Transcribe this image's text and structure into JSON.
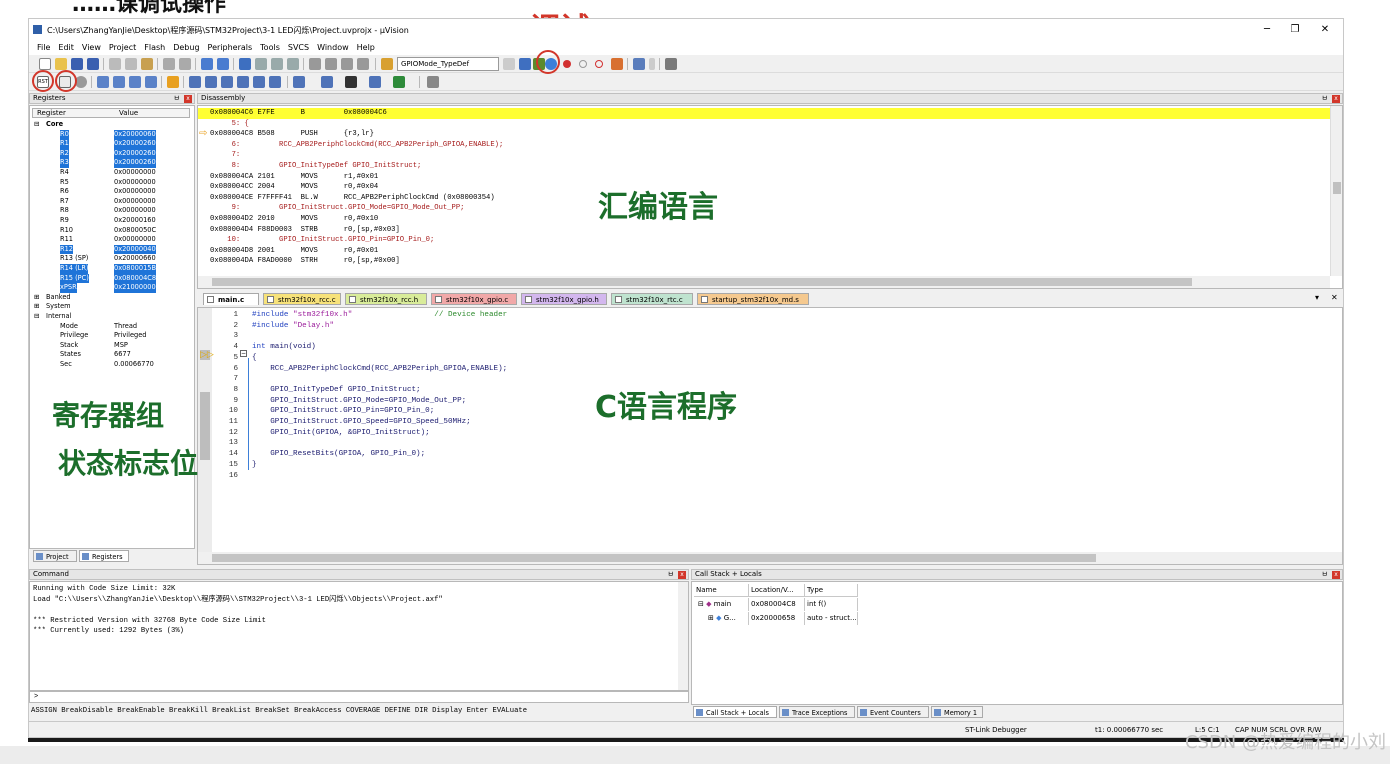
{
  "annotations": {
    "top_partial": "……课调试操作",
    "debug": "调试",
    "asm": "汇编语言",
    "c_prog": "C语言程序",
    "regs": "寄存器组",
    "status": "状态标志位"
  },
  "window": {
    "title": "C:\\Users\\ZhangYanJie\\Desktop\\程序源码\\STM32Project\\3-1 LED闪烁\\Project.uvprojx - µVision",
    "min": "─",
    "max": "❐",
    "close": "✕"
  },
  "menu": [
    "File",
    "Edit",
    "View",
    "Project",
    "Flash",
    "Debug",
    "Peripherals",
    "Tools",
    "SVCS",
    "Window",
    "Help"
  ],
  "toolbar": {
    "target_combo": "GPIOMode_TypeDef"
  },
  "registers": {
    "title": "Registers",
    "col_register": "Register",
    "col_value": "Value",
    "groups": {
      "core": "Core",
      "banked": "Banked",
      "system": "System",
      "internal": "Internal"
    },
    "core": [
      {
        "name": "R0",
        "value": "0x20000060",
        "sel": true
      },
      {
        "name": "R1",
        "value": "0x20000260",
        "sel": true
      },
      {
        "name": "R2",
        "value": "0x20000260",
        "sel": true
      },
      {
        "name": "R3",
        "value": "0x20000260",
        "sel": true
      },
      {
        "name": "R4",
        "value": "0x00000000",
        "sel": false
      },
      {
        "name": "R5",
        "value": "0x00000000",
        "sel": false
      },
      {
        "name": "R6",
        "value": "0x00000000",
        "sel": false
      },
      {
        "name": "R7",
        "value": "0x00000000",
        "sel": false
      },
      {
        "name": "R8",
        "value": "0x00000000",
        "sel": false
      },
      {
        "name": "R9",
        "value": "0x20000160",
        "sel": false
      },
      {
        "name": "R10",
        "value": "0x0800050C",
        "sel": false
      },
      {
        "name": "R11",
        "value": "0x00000000",
        "sel": false
      },
      {
        "name": "R12",
        "value": "0x20000040",
        "sel": true
      },
      {
        "name": "R13 (SP)",
        "value": "0x20000660",
        "sel": false
      },
      {
        "name": "R14 (LR)",
        "value": "0x0800015B",
        "sel": true
      },
      {
        "name": "R15 (PC)",
        "value": "0x080004C8",
        "sel": true
      },
      {
        "name": "xPSR",
        "value": "0x21000000",
        "sel": true
      }
    ],
    "internal": [
      {
        "name": "Mode",
        "value": "Thread"
      },
      {
        "name": "Privilege",
        "value": "Privileged"
      },
      {
        "name": "Stack",
        "value": "MSP"
      },
      {
        "name": "States",
        "value": "6677"
      },
      {
        "name": "Sec",
        "value": "0.00066770"
      }
    ],
    "tab_project": "Project",
    "tab_registers": "Registers"
  },
  "disassembly": {
    "title": "Disassembly",
    "lines": [
      {
        "t": "0x080004C6 E7FE      B         0x080004C6",
        "src": false,
        "hl": true
      },
      {
        "t": "     5: {",
        "src": true,
        "hl": false
      },
      {
        "t": "0x080004C8 B508      PUSH      {r3,lr}",
        "src": false,
        "hl": false
      },
      {
        "t": "     6:         RCC_APB2PeriphClockCmd(RCC_APB2Periph_GPIOA,ENABLE);",
        "src": true,
        "hl": false
      },
      {
        "t": "     7:",
        "src": true,
        "hl": false
      },
      {
        "t": "     8:         GPIO_InitTypeDef GPIO_InitStruct;",
        "src": true,
        "hl": false
      },
      {
        "t": "0x080004CA 2101      MOVS      r1,#0x01",
        "src": false,
        "hl": false
      },
      {
        "t": "0x080004CC 2004      MOVS      r0,#0x04",
        "src": false,
        "hl": false
      },
      {
        "t": "0x080004CE F7FFFF41  BL.W      RCC_APB2PeriphClockCmd (0x08000354)",
        "src": false,
        "hl": false
      },
      {
        "t": "     9:         GPIO_InitStruct.GPIO_Mode=GPIO_Mode_Out_PP;",
        "src": true,
        "hl": false
      },
      {
        "t": "0x080004D2 2010      MOVS      r0,#0x10",
        "src": false,
        "hl": false
      },
      {
        "t": "0x080004D4 F88D0003  STRB      r0,[sp,#0x03]",
        "src": false,
        "hl": false
      },
      {
        "t": "    10:         GPIO_InitStruct.GPIO_Pin=GPIO_Pin_0;",
        "src": true,
        "hl": false
      },
      {
        "t": "0x080004D8 2001      MOVS      r0,#0x01",
        "src": false,
        "hl": false
      },
      {
        "t": "0x080004DA F8AD0000  STRH      r0,[sp,#0x00]",
        "src": false,
        "hl": false
      }
    ]
  },
  "editor": {
    "tabs": [
      "main.c",
      "stm32f10x_rcc.c",
      "stm32f10x_rcc.h",
      "stm32f10x_gpio.c",
      "stm32f10x_gpio.h",
      "stm32f10x_rtc.c",
      "startup_stm32f10x_md.s"
    ],
    "line_numbers": [
      "1",
      "2",
      "3",
      "4",
      "5",
      "6",
      "7",
      "8",
      "9",
      "10",
      "11",
      "12",
      "13",
      "14",
      "15",
      "16"
    ],
    "lines": [
      {
        "kw": "#include",
        "rest": " \"stm32f10x.h\"",
        "cmt": "                  // Device header"
      },
      {
        "kw": "#include",
        "rest": " \"Delay.h\"",
        "cmt": ""
      },
      {
        "kw": "",
        "rest": "",
        "cmt": ""
      },
      {
        "kw": "int",
        "rest": " main(void)",
        "cmt": ""
      },
      {
        "kw": "",
        "rest": "{",
        "cmt": ""
      },
      {
        "kw": "",
        "rest": "    RCC_APB2PeriphClockCmd(RCC_APB2Periph_GPIOA,ENABLE);",
        "cmt": ""
      },
      {
        "kw": "",
        "rest": "",
        "cmt": ""
      },
      {
        "kw": "",
        "rest": "    GPIO_InitTypeDef GPIO_InitStruct;",
        "cmt": ""
      },
      {
        "kw": "",
        "rest": "    GPIO_InitStruct.GPIO_Mode=GPIO_Mode_Out_PP;",
        "cmt": ""
      },
      {
        "kw": "",
        "rest": "    GPIO_InitStruct.GPIO_Pin=GPIO_Pin_0;",
        "cmt": ""
      },
      {
        "kw": "",
        "rest": "    GPIO_InitStruct.GPIO_Speed=GPIO_Speed_50MHz;",
        "cmt": ""
      },
      {
        "kw": "",
        "rest": "    GPIO_Init(GPIOA, &GPIO_InitStruct);",
        "cmt": ""
      },
      {
        "kw": "",
        "rest": "",
        "cmt": ""
      },
      {
        "kw": "",
        "rest": "    GPIO_ResetBits(GPIOA, GPIO_Pin_0);",
        "cmt": ""
      },
      {
        "kw": "",
        "rest": "}",
        "cmt": ""
      },
      {
        "kw": "",
        "rest": "",
        "cmt": ""
      }
    ]
  },
  "command": {
    "title": "Command",
    "lines": [
      "Running with Code Size Limit: 32K",
      "Load \"C:\\\\Users\\\\ZhangYanJie\\\\Desktop\\\\程序源码\\\\STM32Project\\\\3-1 LED闪烁\\\\Objects\\\\Project.axf\"",
      "",
      "*** Restricted Version with 32768 Byte Code Size Limit",
      "*** Currently used: 1292 Bytes (3%)"
    ],
    "prompt": ">",
    "hint": "ASSIGN BreakDisable BreakEnable BreakKill BreakList BreakSet BreakAccess COVERAGE DEFINE DIR Display Enter EVALuate"
  },
  "callstack": {
    "title": "Call Stack + Locals",
    "col_name": "Name",
    "col_loc": "Location/V...",
    "col_type": "Type",
    "rows": [
      {
        "name": "main",
        "loc": "0x080004C8",
        "type": "int f()"
      },
      {
        "name": "G...",
        "loc": "0x20000658",
        "type": "auto - struct..."
      }
    ],
    "tabs": [
      "Call Stack + Locals",
      "Trace Exceptions",
      "Event Counters",
      "Memory 1"
    ]
  },
  "status": {
    "debugger": "ST-Link Debugger",
    "time": "t1: 0.00066770 sec",
    "pos": "L:5 C:1",
    "flags": "CAP  NUM  SCRL  OVR  R/W"
  },
  "watermark": "CSDN @热爱编程的小刘",
  "colors": {
    "accent": "#1f74d8",
    "annotation_red": "#d2362a",
    "annotation_green": "#1c6e2b",
    "pc_highlight": "#ffff33"
  }
}
